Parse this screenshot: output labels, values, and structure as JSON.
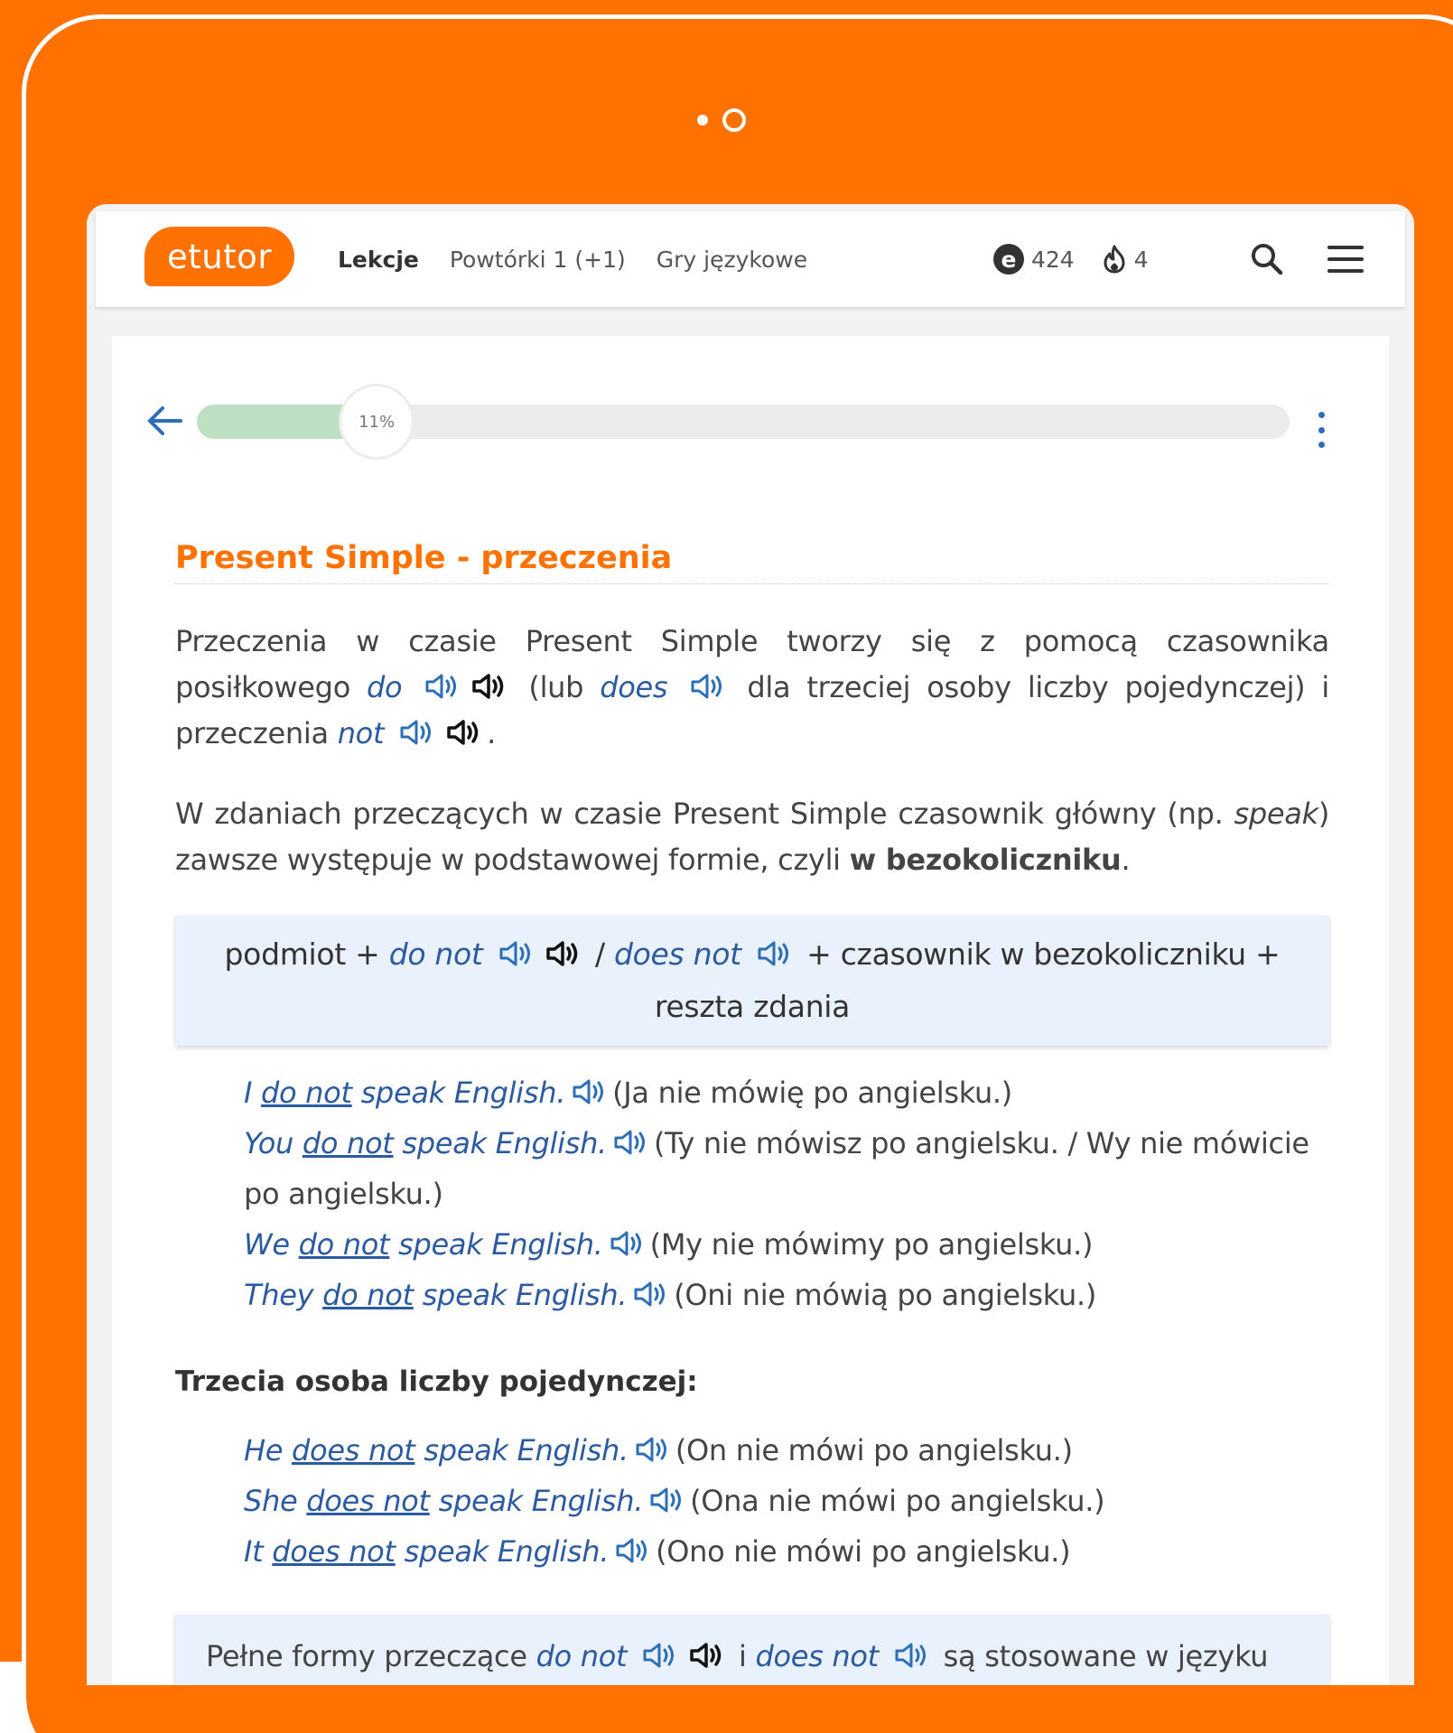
{
  "brand": {
    "logo_text": "etutor",
    "accent": "#ff7100",
    "link_color": "#2c5aa0"
  },
  "nav": {
    "items": [
      "Lekcje",
      "Powtórki 1 (+1)",
      "Gry językowe"
    ],
    "active": "Lekcje"
  },
  "stats": {
    "points_icon": "e-coin-icon",
    "points": "424",
    "streak_icon": "flame-icon",
    "streak": "4"
  },
  "progress": {
    "percent_label": "11%",
    "fraction": 0.11
  },
  "lesson": {
    "title": "Present Simple - przeczenia",
    "p1": {
      "t1": "Przeczenia w czasie Present Simple tworzy się z pomocą czasownika posiłkowego ",
      "w1": "do",
      "t2": " (lub ",
      "w2": "does",
      "t3": " dla trzeciej osoby liczby pojedynczej) i przeczenia ",
      "w3": "not",
      "t4": "."
    },
    "p2": {
      "t1": "W zdaniach przeczących w czasie Present Simple czasownik główny (np. ",
      "w1": "speak",
      "t2": ") zawsze występuje w podstawowej formie, czyli ",
      "bold": "w bezokoliczniku",
      "t3": "."
    },
    "formula": {
      "t1": "podmiot + ",
      "w1": "do not",
      "t2": " / ",
      "w2": "does not",
      "t3": " + czasownik w bezokoliczniku + reszta zdania"
    },
    "examples": [
      {
        "subj": "I",
        "aux": "do not",
        "rest": "speak English.",
        "pl": "(Ja nie mówię po angielsku.)"
      },
      {
        "subj": "You",
        "aux": "do not",
        "rest": "speak English.",
        "pl": "(Ty nie mówisz po angielsku. / Wy nie mówicie po angielsku.)"
      },
      {
        "subj": "We",
        "aux": "do not",
        "rest": "speak English.",
        "pl": "(My nie mówimy po angielsku.)"
      },
      {
        "subj": "They",
        "aux": "do not",
        "rest": "speak English.",
        "pl": "(Oni nie mówią po angielsku.)"
      }
    ],
    "subhead": "Trzecia osoba liczby pojedynczej:",
    "examples3": [
      {
        "subj": "He",
        "aux": "does not",
        "rest": "speak English.",
        "pl": "(On nie mówi po angielsku.)"
      },
      {
        "subj": "She",
        "aux": "does not",
        "rest": "speak English.",
        "pl": "(Ona nie mówi po angielsku.)"
      },
      {
        "subj": "It",
        "aux": "does not",
        "rest": "speak English.",
        "pl": "(Ono nie mówi po angielsku.)"
      }
    ],
    "note": {
      "t1": "Pełne formy przeczące ",
      "w1": "do not",
      "t2": " i ",
      "w2": "does not",
      "t3": " są stosowane w języku"
    }
  }
}
